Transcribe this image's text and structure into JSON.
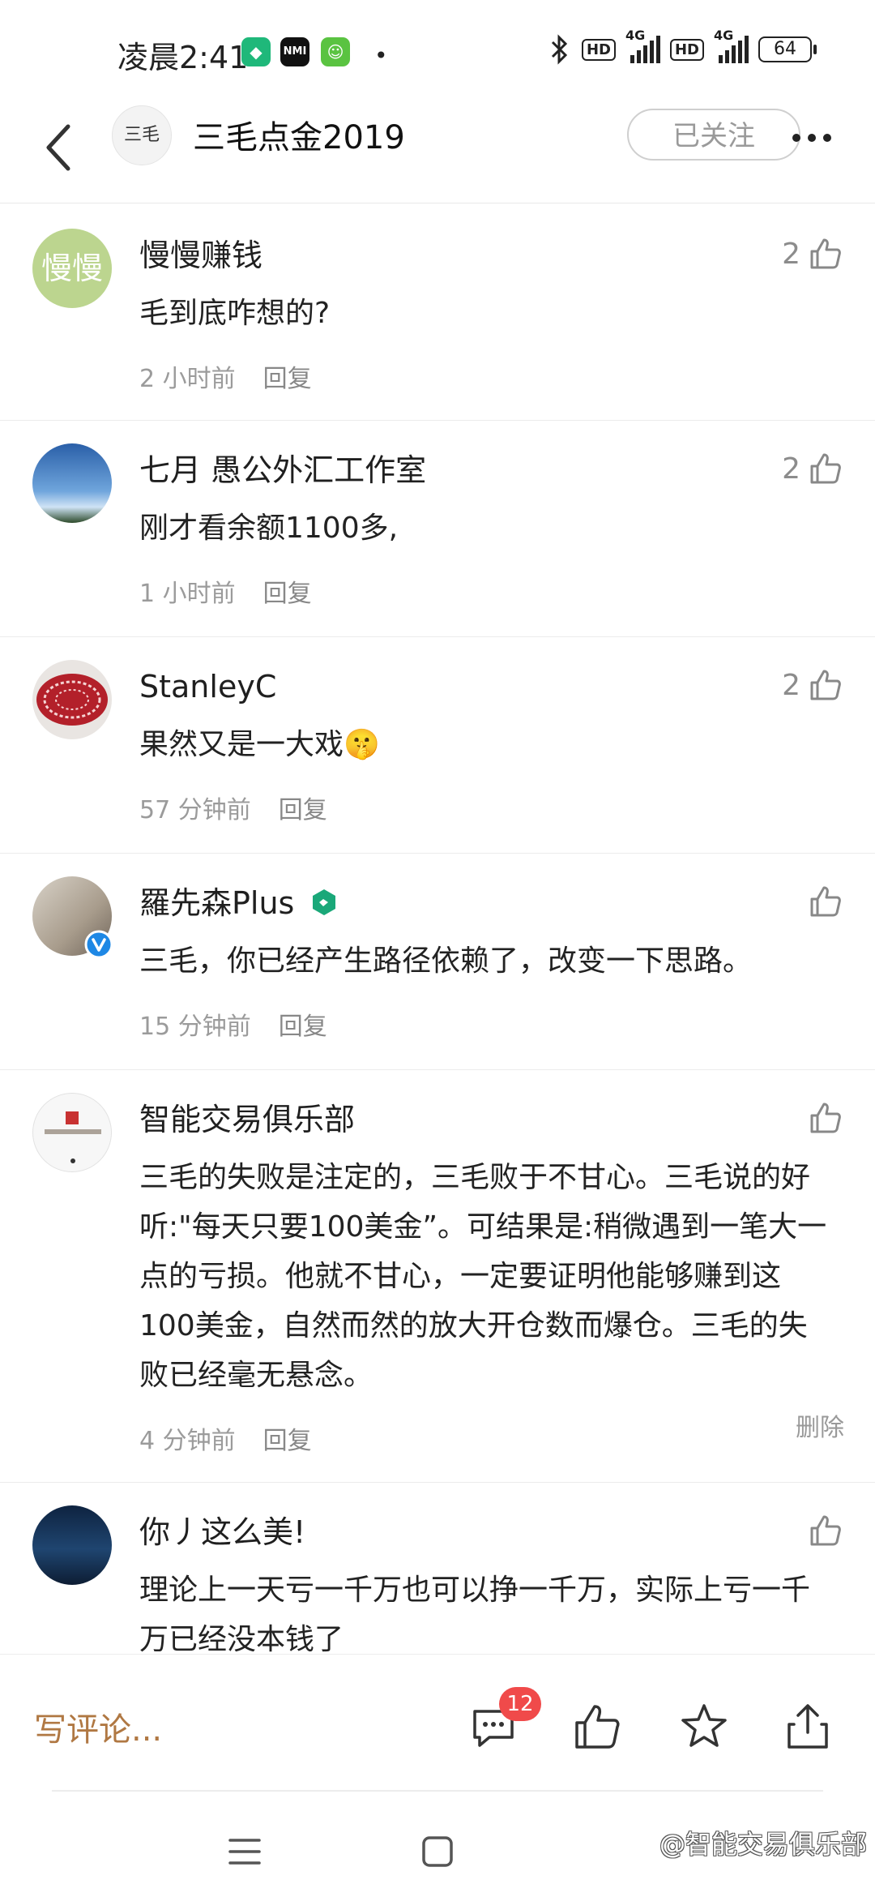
{
  "status_bar": {
    "time": "凌晨2:41",
    "net1": "4G",
    "net2": "4G",
    "hd": "HD",
    "battery": "64"
  },
  "header": {
    "avatar_text": "三毛",
    "title": "三毛点金2019",
    "follow_label": "已关注"
  },
  "comments": [
    {
      "user": "慢慢赚钱",
      "avatar_text": "慢慢",
      "text": "毛到底咋想的?",
      "time": "2 小时前",
      "reply": "回复",
      "likes": "2"
    },
    {
      "user": "七月 愚公外汇工作室",
      "text": "刚才看余额1100多,",
      "time": "1 小时前",
      "reply": "回复",
      "likes": "2"
    },
    {
      "user": "StanleyC",
      "text": "果然又是一大戏🤫",
      "time": "57 分钟前",
      "reply": "回复",
      "likes": "2"
    },
    {
      "user": "羅先森Plus",
      "text": "三毛，你已经产生路径依赖了，改变一下思路。",
      "time": "15 分钟前",
      "reply": "回复",
      "likes": ""
    },
    {
      "user": "智能交易俱乐部",
      "text": "三毛的失败是注定的，三毛败于不甘心。三毛说的好听:\"每天只要100美金”。可结果是:稍微遇到一笔大一点的亏损。他就不甘心，一定要证明他能够赚到这100美金，自然而然的放大开仓数而爆仓。三毛的失败已经毫无悬念。",
      "time": "4 分钟前",
      "reply": "回复",
      "delete": "删除",
      "likes": ""
    },
    {
      "user": "你丿这么美!",
      "text": "理论上一天亏一千万也可以挣一千万，实际上亏一千万已经没本钱了",
      "likes": ""
    }
  ],
  "bottom_bar": {
    "write_placeholder": "写评论...",
    "comment_count": "12"
  },
  "watermark": "@智能交易俱乐部",
  "colors": {
    "accent": "#b07843",
    "badge": "#f04a4a",
    "verified": "#1e88e5"
  }
}
